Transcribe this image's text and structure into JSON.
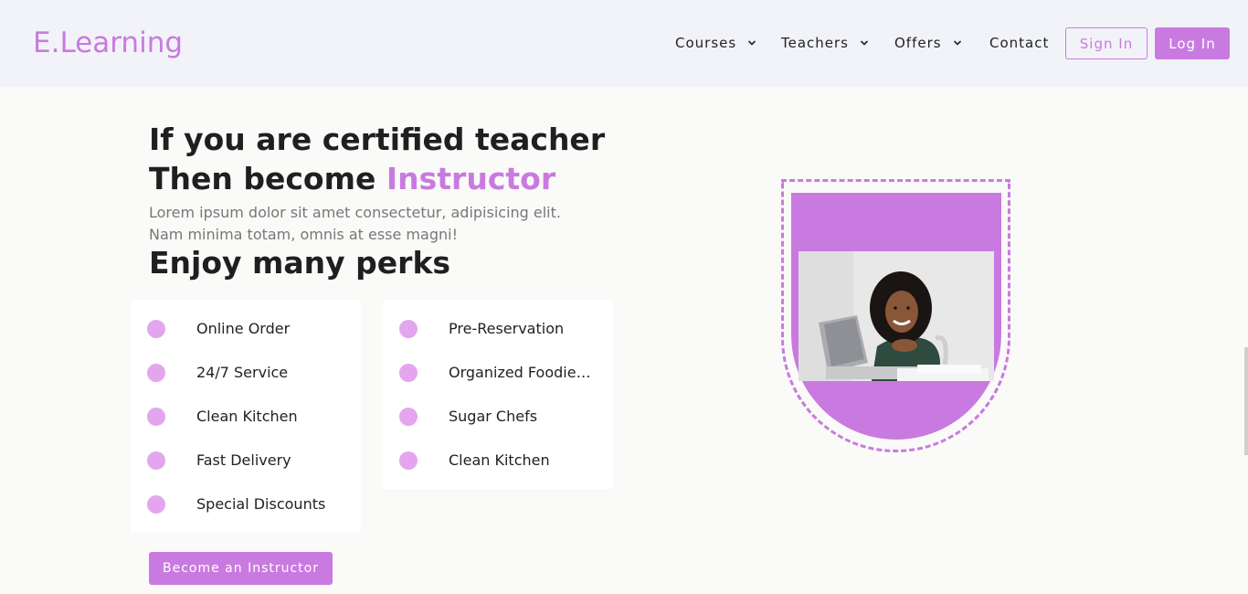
{
  "brand": {
    "logo": "E.Learning",
    "accent_color": "#c97ae0"
  },
  "nav": {
    "items": [
      {
        "label": "Courses",
        "has_dropdown": true,
        "icon": "chevron-down-icon"
      },
      {
        "label": "Teachers",
        "has_dropdown": true,
        "icon": "chevron-down-icon"
      },
      {
        "label": "Offers",
        "has_dropdown": true,
        "icon": "chevron-down-icon"
      },
      {
        "label": "Contact",
        "has_dropdown": false
      }
    ],
    "sign_in": "Sign In",
    "log_in": "Log In"
  },
  "hero": {
    "line1": "If you are certified teacher",
    "line2_prefix": "Then become ",
    "line2_highlight": "Instructor",
    "lead": "Lorem ipsum dolor sit amet consectetur, adipisicing elit. Nam minima totam, omnis at esse magni!",
    "perks_title": "Enjoy many perks"
  },
  "perks": {
    "left": [
      "Online Order",
      "24/7 Service",
      "Clean Kitchen",
      "Fast Delivery",
      "Special Discounts"
    ],
    "right": [
      "Pre-Reservation",
      "Organized Foodies Gr",
      "Sugar Chefs",
      "Clean Kitchen"
    ]
  },
  "cta": {
    "label": "Become an Instructor"
  },
  "media": {
    "photo_icon": "teacher-photo"
  }
}
